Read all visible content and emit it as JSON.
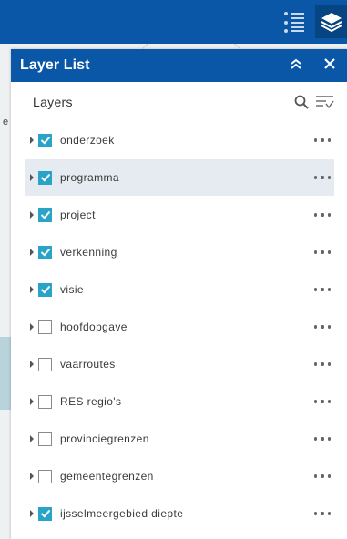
{
  "map": {
    "fragment_text": "e"
  },
  "toolbar": {
    "legend_icon": "legend-list-icon",
    "layers_icon": "layers-stack-icon",
    "color": "#0a57a8",
    "active_color": "#064482"
  },
  "panel": {
    "title": "Layer List",
    "collapse_icon": "double-chevron-up-icon",
    "close_icon": "close-icon",
    "section_title": "Layers",
    "search_icon": "search-icon",
    "filter_icon": "filter-list-icon",
    "accent": "#2aa3c9"
  },
  "layers": [
    {
      "label": "onderzoek",
      "checked": true,
      "highlight": false
    },
    {
      "label": "programma",
      "checked": true,
      "highlight": true
    },
    {
      "label": "project",
      "checked": true,
      "highlight": false
    },
    {
      "label": "verkenning",
      "checked": true,
      "highlight": false
    },
    {
      "label": "visie",
      "checked": true,
      "highlight": false
    },
    {
      "label": "hoofdopgave",
      "checked": false,
      "highlight": false
    },
    {
      "label": "vaarroutes",
      "checked": false,
      "highlight": false
    },
    {
      "label": "RES regio's",
      "checked": false,
      "highlight": false
    },
    {
      "label": "provinciegrenzen",
      "checked": false,
      "highlight": false
    },
    {
      "label": "gemeentegrenzen",
      "checked": false,
      "highlight": false
    },
    {
      "label": "ijsselmeergebied diepte",
      "checked": true,
      "highlight": false
    }
  ]
}
